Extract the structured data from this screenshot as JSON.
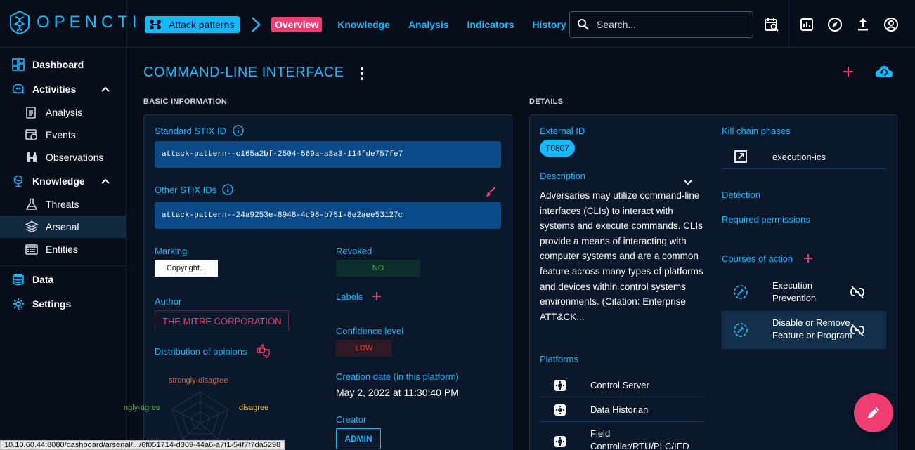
{
  "app": {
    "name": "OPENCTI"
  },
  "topbar": {
    "entity_chip": "Attack patterns",
    "tabs": [
      {
        "label": "Overview",
        "active": true
      },
      {
        "label": "Knowledge"
      },
      {
        "label": "Analysis"
      },
      {
        "label": "Indicators"
      },
      {
        "label": "History"
      }
    ],
    "search_placeholder": "Search..."
  },
  "sidebar": {
    "items": [
      {
        "label": "Dashboard",
        "icon": "dashboard-icon"
      },
      {
        "label": "Activities",
        "icon": "activities-icon",
        "expanded": true
      },
      {
        "label": "Analysis",
        "icon": "analysis-icon"
      },
      {
        "label": "Events",
        "icon": "events-icon"
      },
      {
        "label": "Observations",
        "icon": "observations-icon"
      },
      {
        "label": "Knowledge",
        "icon": "knowledge-icon",
        "expanded": true
      },
      {
        "label": "Threats",
        "icon": "threats-icon"
      },
      {
        "label": "Arsenal",
        "icon": "arsenal-icon",
        "active": true
      },
      {
        "label": "Entities",
        "icon": "entities-icon"
      },
      {
        "label": "Data",
        "icon": "data-icon"
      },
      {
        "label": "Settings",
        "icon": "settings-icon"
      }
    ]
  },
  "page": {
    "title": "COMMAND-LINE INTERFACE"
  },
  "basic": {
    "section_label": "BASIC INFORMATION",
    "standard_stix_id_label": "Standard STIX ID",
    "standard_stix_id": "attack-pattern--c165a2bf-2504-569a-a8a3-114fde757fe7",
    "other_stix_ids_label": "Other STIX IDs",
    "other_stix_id": "attack-pattern--24a9253e-8948-4c98-b751-8e2aee53127c",
    "marking_label": "Marking",
    "marking": "Copyright...",
    "author_label": "Author",
    "author": "THE MITRE CORPORATION",
    "opinions_label": "Distribution of opinions",
    "radar_labels": {
      "top": "strongly-disagree",
      "right": "disagree",
      "left": "ngly-agree"
    },
    "revoked_label": "Revoked",
    "revoked": "NO",
    "labels_label": "Labels",
    "confidence_label": "Confidence level",
    "confidence": "LOW",
    "creation_date_label": "Creation date (in this platform)",
    "creation_date": "May 2, 2022 at 11:30:40 PM",
    "creator_label": "Creator",
    "creator": "ADMIN"
  },
  "details": {
    "section_label": "DETAILS",
    "external_id_label": "External ID",
    "external_id": "T0807",
    "description_label": "Description",
    "description": "Adversaries may utilize command-line interfaces (CLIs) to interact with systems and execute commands. CLIs provide a means of interacting with computer systems and are a common feature across many types of platforms and devices within control systems environments. (Citation: Enterprise ATT&CK...",
    "platforms_label": "Platforms",
    "platforms": [
      "Control Server",
      "Data Historian",
      "Field Controller/RTU/PLC/IED"
    ],
    "kill_chain_label": "Kill chain phases",
    "kill_chain_phase": "execution-ics",
    "detection_label": "Detection",
    "permissions_label": "Required permissions",
    "coa_label": "Courses of action",
    "courses_of_action": [
      "Execution Prevention",
      "Disable or Remove Feature or Program"
    ]
  },
  "status_url": "10.10.60.44:8080/dashboard/arsenal/.../6f051714-d309-44a6-a7f1-54f7f7da5298",
  "colors": {
    "accent": "#0fbcff",
    "pink": "#f03e73",
    "bg": "#070d19",
    "card": "#09182a"
  }
}
